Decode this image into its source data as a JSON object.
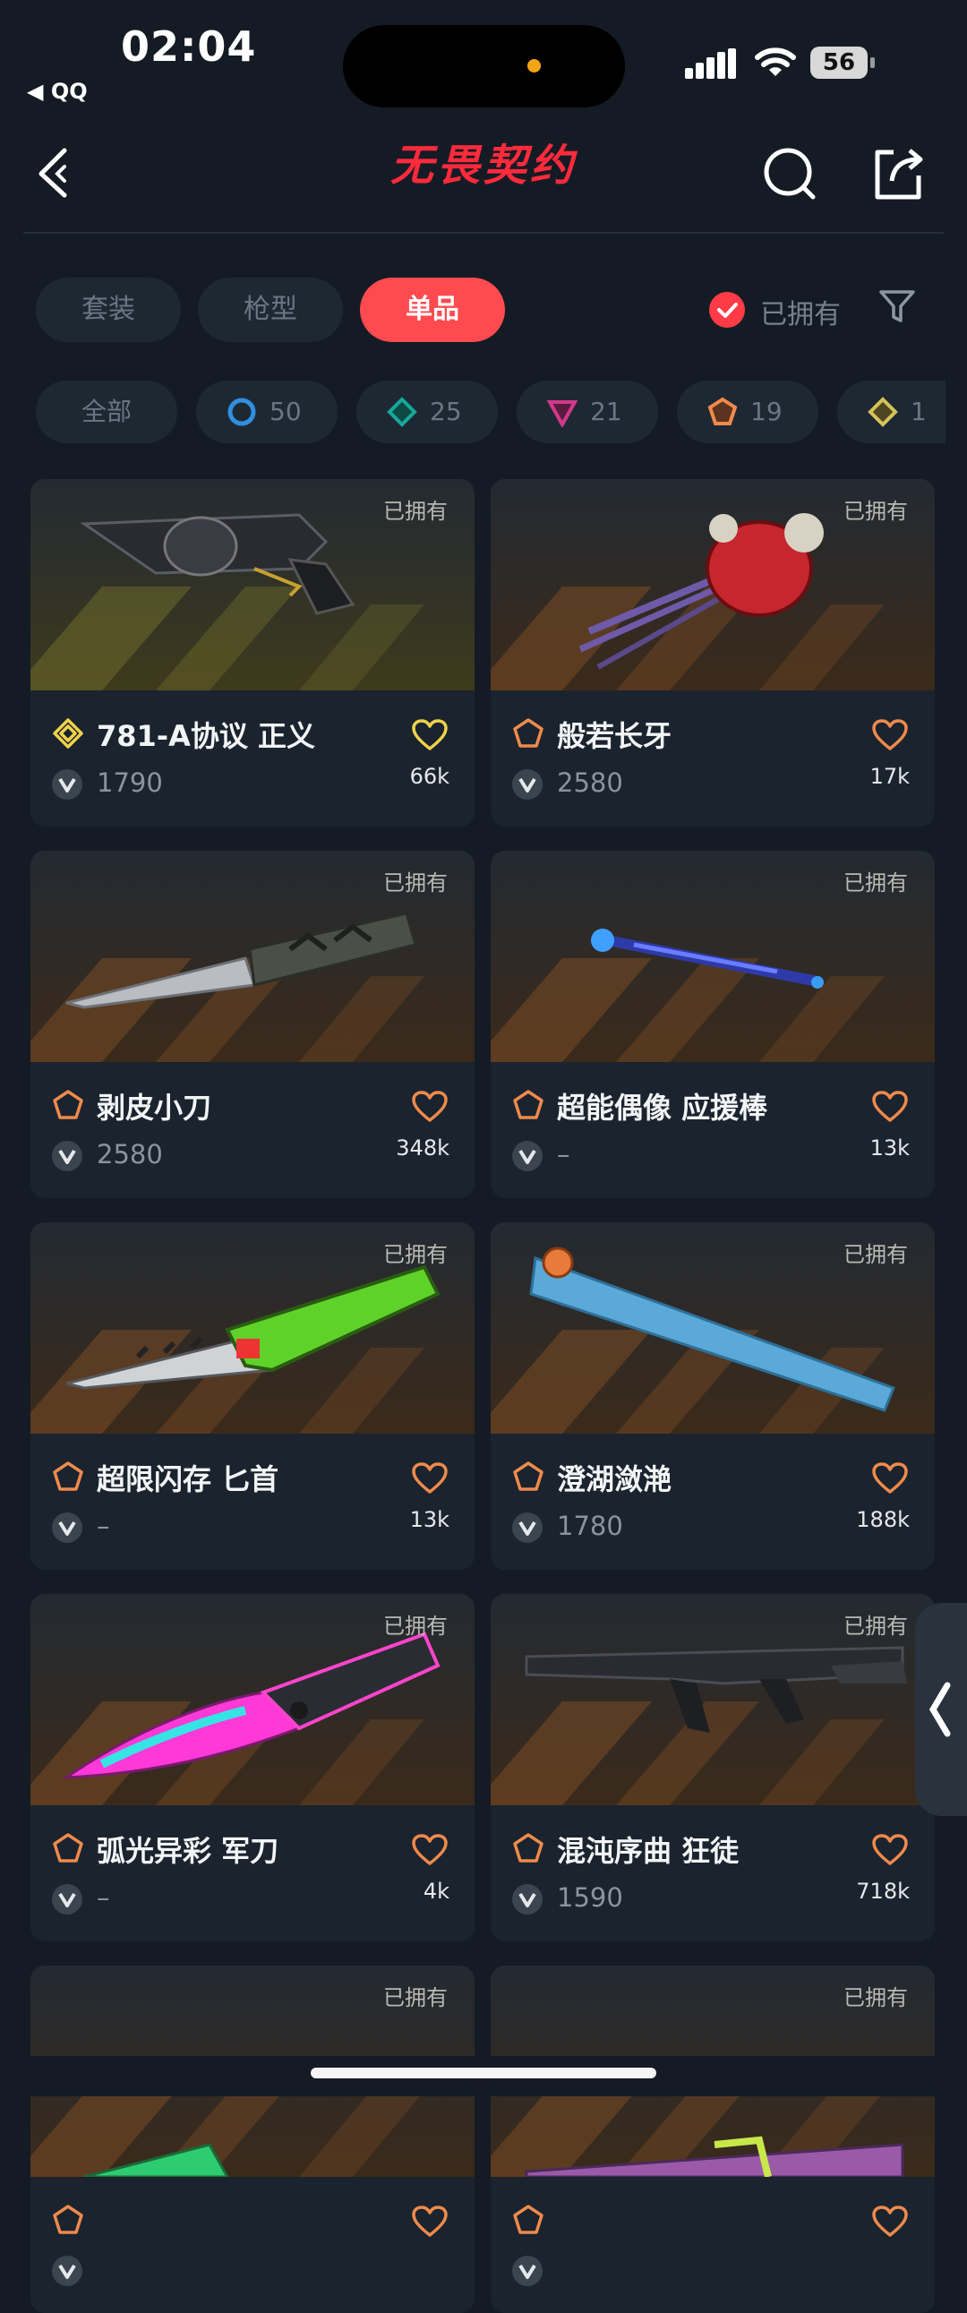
{
  "status_bar": {
    "time": "02:04",
    "back_app": "◀ QQ",
    "battery": "56"
  },
  "header": {
    "logo_text": "无畏契约"
  },
  "category_tabs": [
    {
      "label": "套装",
      "active": false
    },
    {
      "label": "枪型",
      "active": false
    },
    {
      "label": "单品",
      "active": true
    }
  ],
  "owned_filter": {
    "label": "已拥有",
    "checked": true
  },
  "tiers": [
    {
      "label": "全部"
    },
    {
      "count": "50",
      "tier": "select",
      "color": "#2f8fe0"
    },
    {
      "count": "25",
      "tier": "deluxe",
      "color": "#17a89a"
    },
    {
      "count": "21",
      "tier": "premium",
      "color": "#d0398a"
    },
    {
      "count": "19",
      "tier": "exclusive",
      "color": "#f08a4b"
    },
    {
      "count": "1",
      "tier": "ultra",
      "color": "#d6c25a"
    }
  ],
  "cards": [
    {
      "name": "781-A协议 正义",
      "price": "1790",
      "likes": "66k",
      "owned": "已拥有",
      "tier": "ultra",
      "tier_color": "#f0d24a",
      "heart_color": "#f0d24a"
    },
    {
      "name": "般若长牙",
      "price": "2580",
      "likes": "17k",
      "owned": "已拥有",
      "tier": "exclusive",
      "tier_color": "#f08a4b",
      "heart_color": "#f08a4b"
    },
    {
      "name": "剥皮小刀",
      "price": "2580",
      "likes": "348k",
      "owned": "已拥有",
      "tier": "exclusive",
      "tier_color": "#f08a4b",
      "heart_color": "#f08a4b"
    },
    {
      "name": "超能偶像 应援棒",
      "price": "–",
      "likes": "13k",
      "owned": "已拥有",
      "tier": "exclusive",
      "tier_color": "#f08a4b",
      "heart_color": "#f08a4b"
    },
    {
      "name": "超限闪存 匕首",
      "price": "–",
      "likes": "13k",
      "owned": "已拥有",
      "tier": "exclusive",
      "tier_color": "#f08a4b",
      "heart_color": "#f08a4b"
    },
    {
      "name": "澄湖潋滟",
      "price": "1780",
      "likes": "188k",
      "owned": "已拥有",
      "tier": "exclusive",
      "tier_color": "#f08a4b",
      "heart_color": "#f08a4b"
    },
    {
      "name": "弧光异彩 军刀",
      "price": "–",
      "likes": "4k",
      "owned": "已拥有",
      "tier": "exclusive",
      "tier_color": "#f08a4b",
      "heart_color": "#f08a4b"
    },
    {
      "name": "混沌序曲 狂徒",
      "price": "1590",
      "likes": "718k",
      "owned": "已拥有",
      "tier": "exclusive",
      "tier_color": "#f08a4b",
      "heart_color": "#f08a4b"
    },
    {
      "name": "",
      "price": "",
      "likes": "",
      "owned": "已拥有",
      "tier": "",
      "tier_color": "#f08a4b",
      "heart_color": "#f08a4b"
    },
    {
      "name": "",
      "price": "",
      "likes": "",
      "owned": "已拥有",
      "tier": "",
      "tier_color": "#f08a4b",
      "heart_color": "#f08a4b"
    }
  ]
}
